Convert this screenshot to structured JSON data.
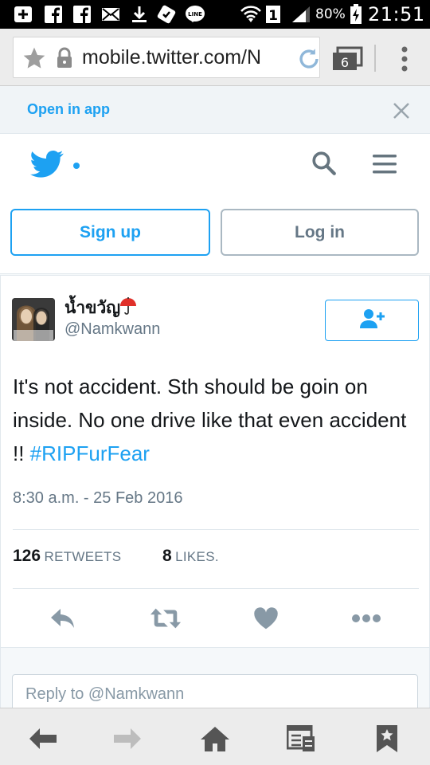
{
  "status_bar": {
    "battery_percent": "80%",
    "time": "21:51"
  },
  "browser": {
    "url": "mobile.twitter.com/N",
    "tab_count": "6"
  },
  "banner": {
    "open_in_app": "Open in app"
  },
  "header": {
    "sign_up": "Sign up",
    "log_in": "Log in"
  },
  "tweet": {
    "display_name": "น้ำขวัญ",
    "handle": "@Namkwann",
    "text": "It's not accident. Sth should be goin on inside. No one drive like that even accident !! ",
    "hashtag": "#RIPFurFear",
    "timestamp": "8:30 a.m. - 25 Feb 2016",
    "retweets_count": "126",
    "retweets_label": "RETWEETS",
    "likes_count": "8",
    "likes_label": "LIKES."
  },
  "reply": {
    "placeholder": "Reply to @Namkwann"
  },
  "colors": {
    "twitter_blue": "#1da1f2",
    "secondary_text": "#657786"
  }
}
